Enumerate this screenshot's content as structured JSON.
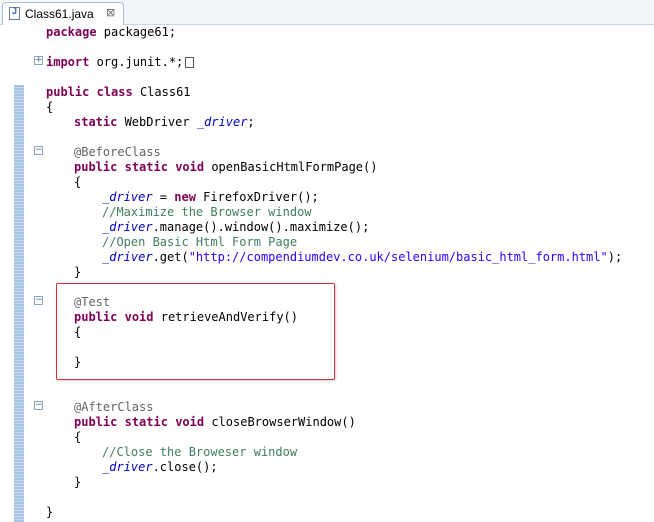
{
  "tab": {
    "label": "Class61.java",
    "close": "⊠",
    "icon": "java-file-icon"
  },
  "code": {
    "l1": [
      "package",
      " package61;"
    ],
    "l2": [
      "import",
      " org.junit.*;"
    ],
    "l3": [
      "public",
      " ",
      "class",
      " Class61"
    ],
    "l4": "{",
    "l5": [
      "static",
      " WebDriver ",
      "_driver",
      ";"
    ],
    "l6": "@BeforeClass",
    "l7": [
      "public",
      " ",
      "static",
      " ",
      "void",
      " openBasicHtmlFormPage()"
    ],
    "l8": "{",
    "l9": [
      "_driver",
      " = ",
      "new",
      " FirefoxDriver();"
    ],
    "l10": "//Maximize the Browser window",
    "l11": [
      "_driver",
      ".manage().window().maximize();"
    ],
    "l12": "//Open Basic Html Form Page",
    "l13": [
      "_driver",
      ".get(",
      "\"http://compendiumdev.co.uk/selenium/basic_html_form.html\"",
      ");"
    ],
    "l14": "}",
    "l15": "@Test",
    "l16": [
      "public",
      " ",
      "void",
      " retrieveAndVerify()"
    ],
    "l17": "{",
    "l18": "}",
    "l19": "@AfterClass",
    "l20": [
      "public",
      " ",
      "static",
      " ",
      "void",
      " closeBrowserWindow()"
    ],
    "l21": "{",
    "l22": "//Close the Broweser window",
    "l23": [
      "_driver",
      ".close();"
    ],
    "l24": "}",
    "l25": "}"
  },
  "colors": {
    "keyword": "#7f0055",
    "annotation": "#646464",
    "comment": "#3f7f5f",
    "string": "#2a00ff",
    "field": "#0000c0",
    "highlight": "#d0343a"
  }
}
